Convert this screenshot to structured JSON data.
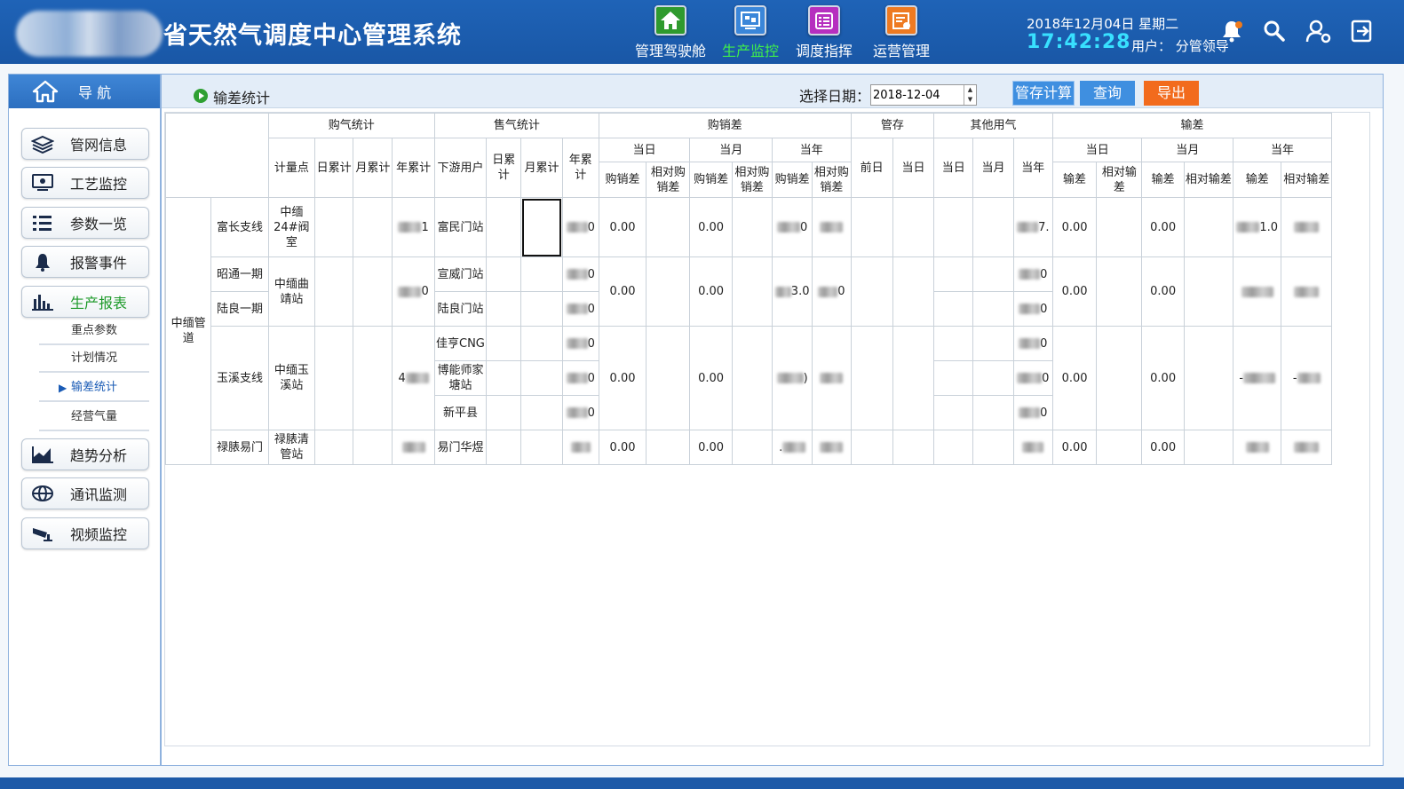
{
  "header": {
    "title": "省天然气调度中心管理系统",
    "nav": [
      {
        "label": "管理驾驶舱",
        "icon": "home-icon",
        "color": "#2f9a2e",
        "active": false
      },
      {
        "label": "生产监控",
        "icon": "monitor-icon",
        "color": "#3a86d9",
        "active": true
      },
      {
        "label": "调度指挥",
        "icon": "list-icon",
        "color": "#b62fbf",
        "active": false
      },
      {
        "label": "运营管理",
        "icon": "edit-icon",
        "color": "#ee7a21",
        "active": false
      }
    ],
    "date": "2018年12月04日  星期二",
    "time": "17:42:28",
    "user": "用户：  分管领导"
  },
  "sidebar": {
    "title": "导  航",
    "items": [
      {
        "label": "管网信息",
        "icon": "layers-icon"
      },
      {
        "label": "工艺监控",
        "icon": "monitor-icon"
      },
      {
        "label": "参数一览",
        "icon": "list-icon"
      },
      {
        "label": "报警事件",
        "icon": "bell-icon"
      },
      {
        "label": "生产报表",
        "icon": "bar-chart-icon"
      },
      {
        "label": "趋势分析",
        "icon": "area-chart-icon"
      },
      {
        "label": "通讯监测",
        "icon": "globe-icon"
      },
      {
        "label": "视频监控",
        "icon": "camera-icon"
      }
    ],
    "subitems": [
      "重点参数",
      "计划情况",
      "输差统计",
      "经营气量"
    ]
  },
  "toolbar": {
    "breadcrumb": "输差统计",
    "date_label": "选择日期：",
    "date_value": "2018-12-04",
    "calc_label": "管存计算",
    "query_label": "查询",
    "export_label": "导出"
  },
  "table": {
    "h1": [
      "购气统计",
      "售气统计",
      "购销差",
      "管存",
      "其他用气",
      "输差"
    ],
    "h2": [
      "当日",
      "当月",
      "当年",
      "当日",
      "当月",
      "当年"
    ],
    "h3": {
      "buy": [
        "计量点",
        "日累计",
        "月累计",
        "年累计"
      ],
      "sell": [
        "下游用户",
        "日累计",
        "月累计",
        "年累计"
      ],
      "diff": [
        "购销差",
        "相对购销差",
        "购销差",
        "相对购销差",
        "购销差",
        "相对购销差"
      ],
      "store": [
        "前日",
        "当日"
      ],
      "other": [
        "当日",
        "当月",
        "当年"
      ],
      "loss": [
        "输差",
        "相对输差",
        "输差",
        "相对输差",
        "输差",
        "相对输差"
      ]
    },
    "pipeline": "中缅管道",
    "rows": {
      "r1": {
        "line": "富长支线",
        "point": "中缅24#阀室",
        "year_frag": "1",
        "user": "富民门站",
        "sell_frag": "0",
        "d1": "0.00",
        "y_frag": "0",
        "oy_frag": "7.",
        "l1": "0.00",
        "l2": "0.00",
        "ly_frag": "1.0"
      },
      "r2": {
        "line": "昭通一期",
        "point": "中缅曲靖站",
        "year_frag": "0",
        "user": "宣威门站",
        "sell_frag": "0",
        "oy_frag": "0"
      },
      "r3": {
        "line": "陆良一期",
        "user": "陆良门站",
        "sell_frag": "0",
        "oy_frag": "0"
      },
      "g1": {
        "d1": "0.00",
        "d2": "0.00",
        "y_frag": "3.0",
        "ry_frag": "0",
        "l1": "0.00",
        "l2": "0.00"
      },
      "r4": {
        "line": "玉溪支线",
        "point": "中缅玉溪站",
        "year_frag": "4",
        "user": "佳亨CNG",
        "sell_frag": "0",
        "oy_frag": "0"
      },
      "r5": {
        "user": "博能师家塘站",
        "sell_frag": "0",
        "oy_frag": "0"
      },
      "r6": {
        "user": "新平县",
        "sell_frag": "0",
        "oy_frag": "0"
      },
      "g2": {
        "d1": "0.00",
        "d2": "0.00",
        "y_frag": ")",
        "l1": "0.00",
        "l2": "0.00",
        "ly_frag": "-",
        "ry_frag": "-"
      },
      "r7": {
        "line": "禄脿易门",
        "point": "禄脿清管站",
        "user": "易门华煜",
        "d1": "0.00",
        "d2": "0.00",
        "y_frag": ".",
        "l1": "0.00",
        "l2": "0.00"
      }
    }
  }
}
